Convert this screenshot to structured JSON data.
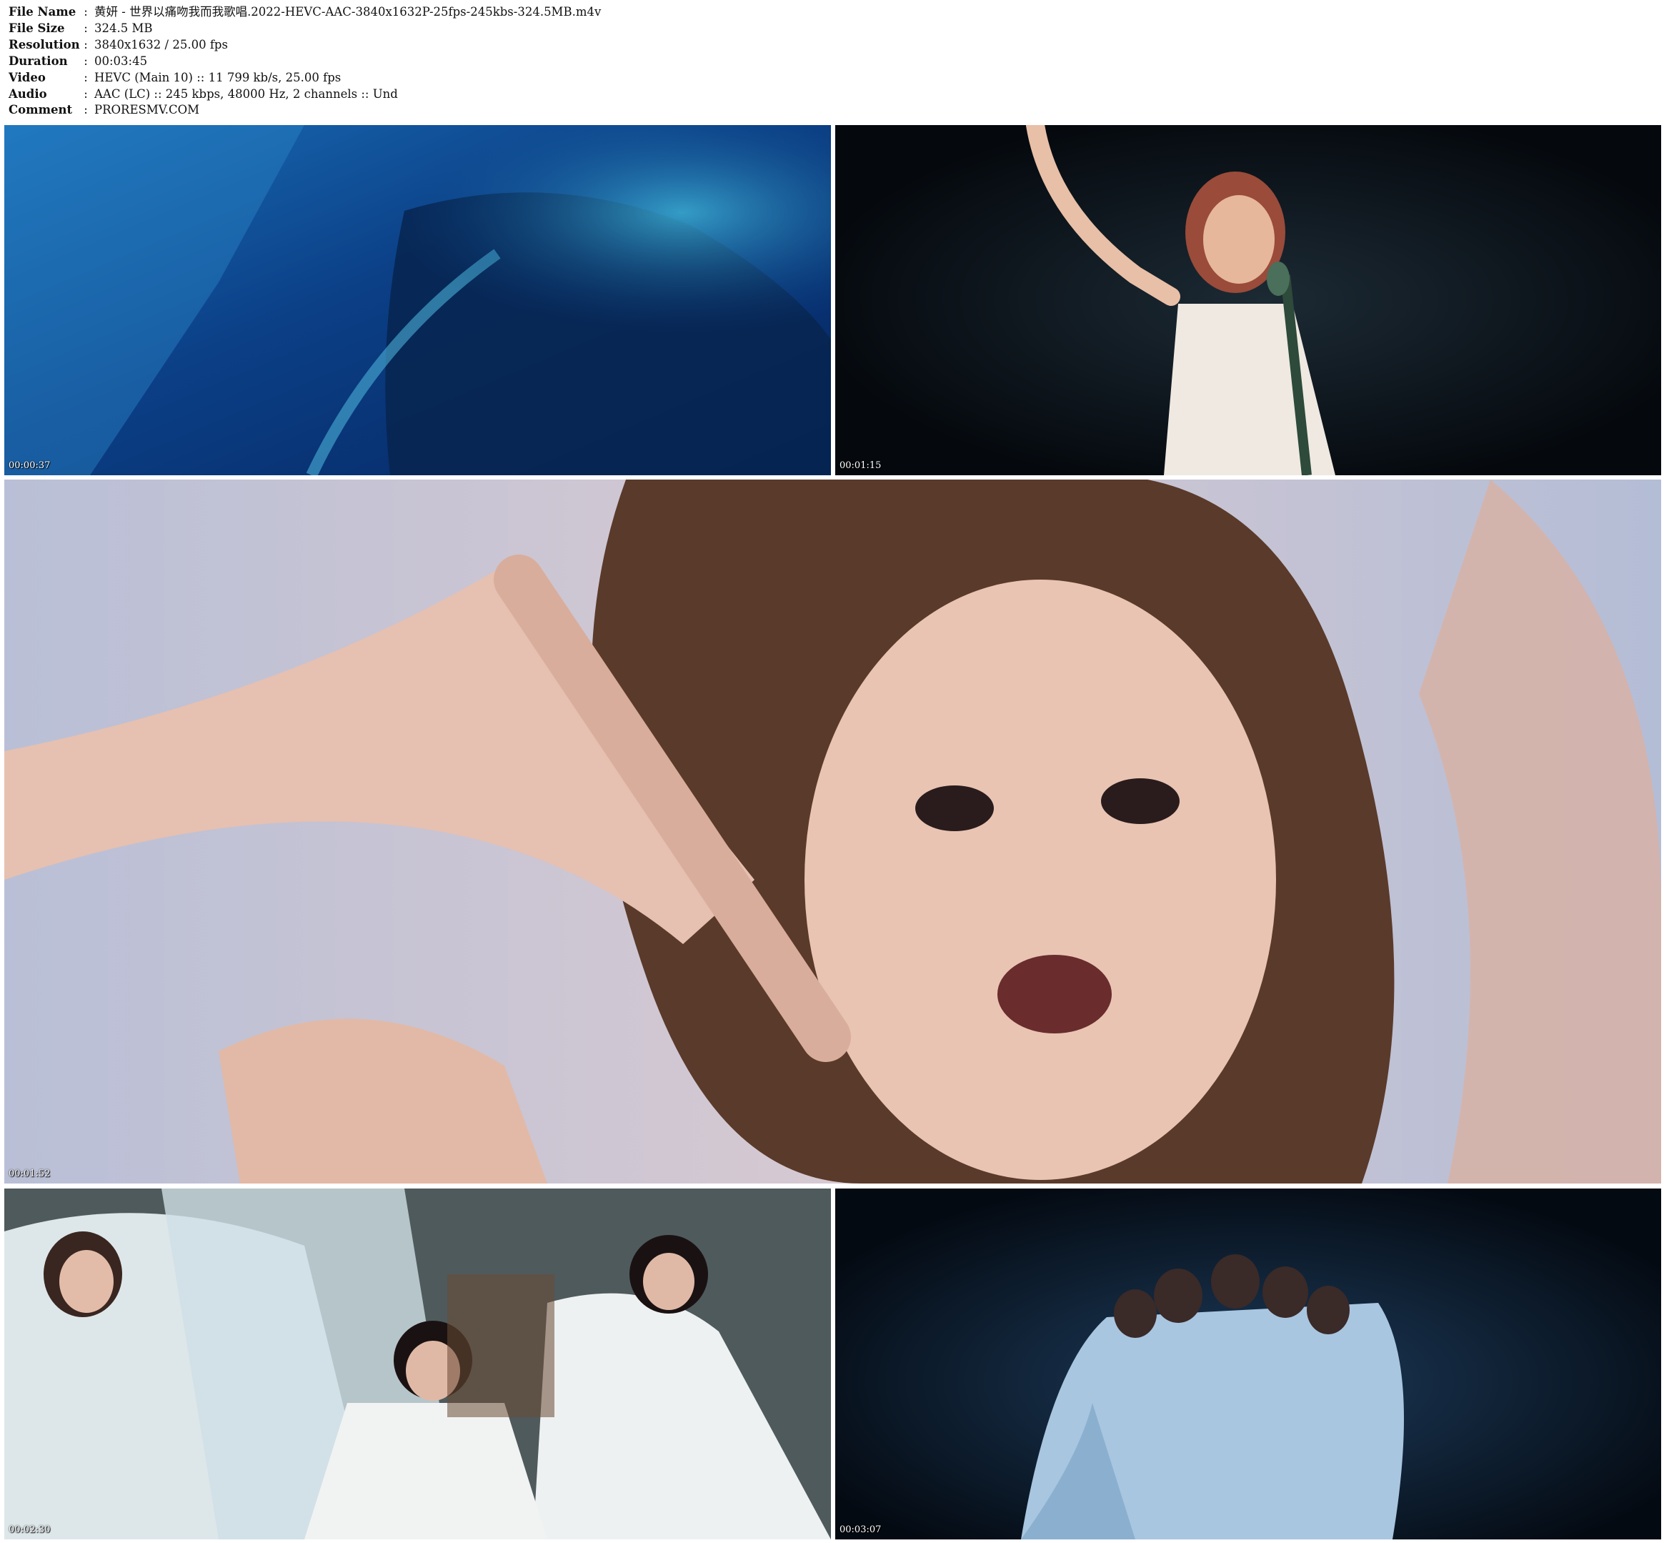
{
  "info": {
    "file_name": {
      "label": "File Name",
      "value": "黄妍 - 世界以痛吻我而我歌唱.2022-HEVC-AAC-3840x1632P-25fps-245kbs-324.5MB.m4v"
    },
    "file_size": {
      "label": "File Size",
      "value": "324.5 MB"
    },
    "resolution": {
      "label": "Resolution",
      "value": "3840x1632 / 25.00 fps"
    },
    "duration": {
      "label": "Duration",
      "value": "00:03:45"
    },
    "video": {
      "label": "Video",
      "value": "HEVC (Main 10) :: 11 799 kb/s, 25.00 fps"
    },
    "audio": {
      "label": "Audio",
      "value": "AAC (LC) :: 245 kbps, 48000 Hz, 2 channels :: Und"
    },
    "comment": {
      "label": "Comment",
      "value": "PRORESMV.COM"
    },
    "separator": ":"
  },
  "frames": [
    {
      "timestamp": "00:00:37"
    },
    {
      "timestamp": "00:01:15"
    },
    {
      "timestamp": "00:01:52"
    },
    {
      "timestamp": "00:02:30"
    },
    {
      "timestamp": "00:03:07"
    }
  ]
}
